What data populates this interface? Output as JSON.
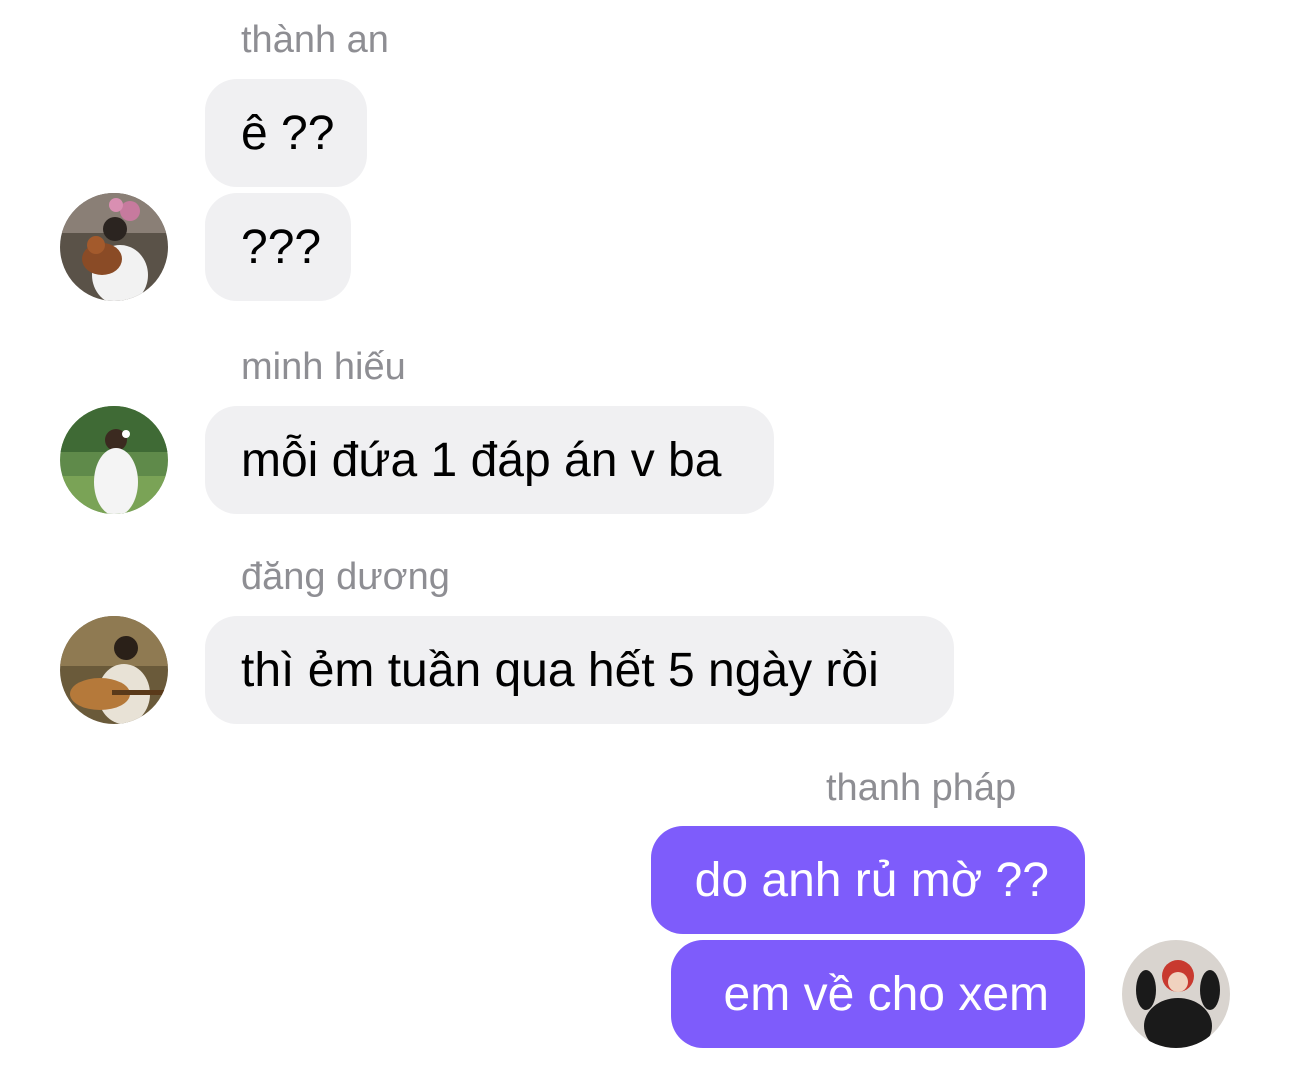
{
  "messages": [
    {
      "sender": "thành an",
      "bubbles": [
        "ê ??",
        "???"
      ],
      "avatar_icon": "person-holding-dog-icon"
    },
    {
      "sender": "minh hiếu",
      "bubbles": [
        "mỗi đứa 1 đáp án v ba"
      ],
      "avatar_icon": "person-in-garden-icon"
    },
    {
      "sender": "đăng dương",
      "bubbles": [
        "thì ẻm tuần qua hết 5 ngày rồi"
      ],
      "avatar_icon": "person-playing-guitar-icon"
    },
    {
      "sender": "thanh pháp",
      "bubbles": [
        "do anh rủ mờ ??",
        "em về cho xem"
      ],
      "avatar_icon": "person-red-hair-icon"
    }
  ],
  "colors": {
    "incoming_bubble": "#f0f0f2",
    "outgoing_bubble": "#7e5cfb",
    "sender_label": "#8e8e93"
  }
}
